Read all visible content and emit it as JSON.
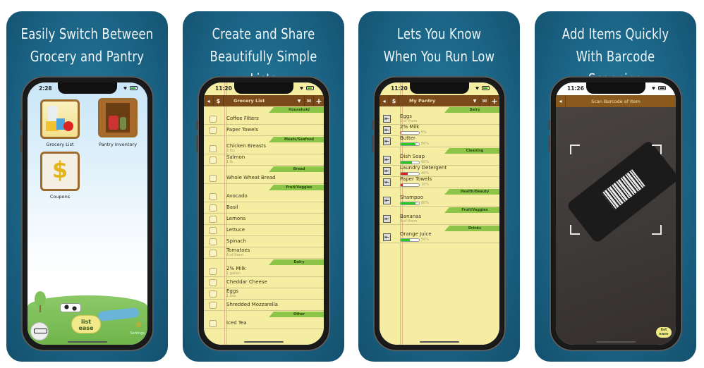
{
  "panels": [
    {
      "title_line1": "Easily Switch Between",
      "title_line2": "Grocery and Pantry",
      "phone": {
        "time": "2:28",
        "home": {
          "tiles": [
            {
              "label": "Grocery List",
              "icon": "grocery-icon"
            },
            {
              "label": "Pantry Inventory",
              "icon": "pantry-cabinet-icon"
            },
            {
              "label": "Coupons",
              "icon": "coupon-dollar-icon"
            }
          ],
          "logo_line1": "list",
          "logo_line2": "ease",
          "settings_label": "Settings"
        }
      }
    },
    {
      "title_line1": "Create and Share",
      "title_line2": "Beautifully Simple Lists",
      "phone": {
        "time": "11:20",
        "nav_title": "Grocery List",
        "sections": [
          {
            "category": "Household",
            "items": [
              {
                "name": "Coffee Filters",
                "sub": ""
              },
              {
                "name": "Paper Towels",
                "sub": ""
              }
            ]
          },
          {
            "category": "Meats/Seafood",
            "items": [
              {
                "name": "Chicken Breasts",
                "sub": "2 lbs"
              },
              {
                "name": "Salmon",
                "sub": "1 lb"
              }
            ]
          },
          {
            "category": "Bread",
            "items": [
              {
                "name": "Whole Wheat Bread",
                "sub": ""
              }
            ]
          },
          {
            "category": "Fruit/Veggies",
            "items": [
              {
                "name": "Avocado",
                "sub": ""
              },
              {
                "name": "Basil",
                "sub": ""
              },
              {
                "name": "Lemons",
                "sub": ""
              },
              {
                "name": "Lettuce",
                "sub": ""
              },
              {
                "name": "Spinach",
                "sub": ""
              },
              {
                "name": "Tomatoes",
                "sub": "4 of them"
              }
            ]
          },
          {
            "category": "Dairy",
            "items": [
              {
                "name": "2% Milk",
                "sub": "1 gallon"
              },
              {
                "name": "Cheddar Cheese",
                "sub": ""
              },
              {
                "name": "Eggs",
                "sub": "1 box"
              },
              {
                "name": "Shredded Mozzarella",
                "sub": ""
              }
            ]
          },
          {
            "category": "Other",
            "items": [
              {
                "name": "Iced Tea",
                "sub": ""
              }
            ]
          }
        ]
      }
    },
    {
      "title_line1": "Lets You Know",
      "title_line2": "When You Run Low",
      "phone": {
        "time": "11:20",
        "nav_title": "My Pantry",
        "sections": [
          {
            "category": "Dairy",
            "items": [
              {
                "name": "Eggs",
                "sub": "2 of them",
                "level": null
              },
              {
                "name": "2% Milk",
                "level": 5,
                "level_label": "5%",
                "color": "#e02020"
              },
              {
                "name": "Butter",
                "level": 80,
                "level_label": "80%",
                "color": "#22cc22"
              }
            ]
          },
          {
            "category": "Cleaning",
            "items": [
              {
                "name": "Dish Soap",
                "level": 60,
                "level_label": "60%",
                "color": "#22cc22"
              },
              {
                "name": "Laundry Detergent",
                "level": 40,
                "level_label": "40%",
                "color": "#e02020"
              },
              {
                "name": "Paper Towels",
                "level": 10,
                "level_label": "10%",
                "color": "#e02020"
              }
            ]
          },
          {
            "category": "Health/Beauty",
            "items": [
              {
                "name": "Shampoo",
                "level": 80,
                "level_label": "80%",
                "color": "#22cc22"
              }
            ]
          },
          {
            "category": "Fruit/Veggies",
            "items": [
              {
                "name": "Bananas",
                "sub": "3 of them",
                "level": null
              }
            ]
          },
          {
            "category": "Drinks",
            "items": [
              {
                "name": "Orange Juice",
                "level": 50,
                "level_label": "50%",
                "color": "#22cc22"
              }
            ]
          }
        ]
      }
    },
    {
      "title_line1": "Add Items Quickly",
      "title_line2": "With Barcode Scanning",
      "phone": {
        "time": "11:26",
        "nav_title": "Scan Barcode of Item",
        "logo_line1": "list",
        "logo_line2": "ease"
      }
    }
  ],
  "colors": {
    "panel_bg": "#1d6a8c",
    "nav_brown": "#7b4a1a",
    "category_green": "#8dc548",
    "notepad_yellow": "#f5eea2",
    "level_green": "#22cc22",
    "level_red": "#e02020"
  }
}
